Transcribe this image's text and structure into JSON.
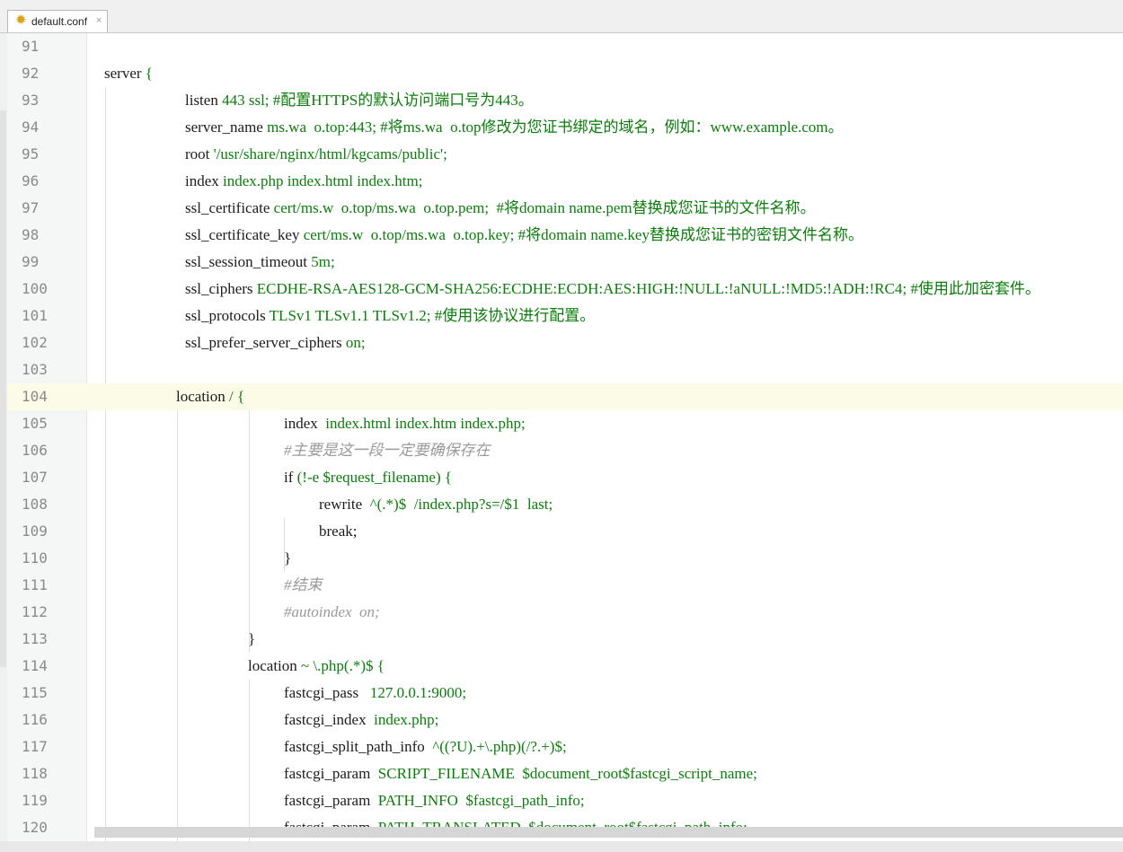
{
  "tab": {
    "label": "default.conf",
    "icon": "gear-icon",
    "close": "×"
  },
  "lines": [
    {
      "n": "91",
      "indent": 0,
      "parts": []
    },
    {
      "n": "92",
      "indent": 108,
      "parts": [
        [
          "kw",
          "server "
        ],
        [
          "val",
          "{"
        ]
      ]
    },
    {
      "n": "93",
      "indent": 198,
      "parts": [
        [
          "kw",
          "listen "
        ],
        [
          "val",
          "443 ssl; #配置HTTPS的默认访问端口号为443。"
        ]
      ]
    },
    {
      "n": "94",
      "indent": 198,
      "parts": [
        [
          "kw",
          "server_name "
        ],
        [
          "val",
          "ms.wa  o.top:443; #将ms.wa  o.top修改为您证书绑定的域名，例如：www.example.com。"
        ]
      ]
    },
    {
      "n": "95",
      "indent": 198,
      "parts": [
        [
          "kw",
          "root "
        ],
        [
          "val",
          "'/usr/share/nginx/html/kgcams/public';"
        ]
      ]
    },
    {
      "n": "96",
      "indent": 198,
      "parts": [
        [
          "kw",
          "index "
        ],
        [
          "val",
          "index.php index.html index.htm;"
        ]
      ]
    },
    {
      "n": "97",
      "indent": 198,
      "parts": [
        [
          "kw",
          "ssl_certificate "
        ],
        [
          "val",
          "cert/ms.w  o.top/ms.wa  o.top.pem;  #将domain name.pem替换成您证书的文件名称。"
        ]
      ]
    },
    {
      "n": "98",
      "indent": 198,
      "parts": [
        [
          "kw",
          "ssl_certificate_key "
        ],
        [
          "val",
          "cert/ms.w  o.top/ms.wa  o.top.key; #将domain name.key替换成您证书的密钥文件名称。"
        ]
      ]
    },
    {
      "n": "99",
      "indent": 198,
      "parts": [
        [
          "kw",
          "ssl_session_timeout "
        ],
        [
          "val",
          "5m;"
        ]
      ]
    },
    {
      "n": "100",
      "indent": 198,
      "parts": [
        [
          "kw",
          "ssl_ciphers "
        ],
        [
          "val",
          "ECDHE-RSA-AES128-GCM-SHA256:ECDHE:ECDH:AES:HIGH:!NULL:!aNULL:!MD5:!ADH:!RC4; #使用此加密套件。"
        ]
      ]
    },
    {
      "n": "101",
      "indent": 198,
      "parts": [
        [
          "kw",
          "ssl_protocols "
        ],
        [
          "val",
          "TLSv1 TLSv1.1 TLSv1.2; #使用该协议进行配置。"
        ]
      ]
    },
    {
      "n": "102",
      "indent": 198,
      "parts": [
        [
          "kw",
          "ssl_prefer_server_ciphers "
        ],
        [
          "val",
          "on;"
        ]
      ]
    },
    {
      "n": "103",
      "indent": 0,
      "parts": []
    },
    {
      "n": "104",
      "indent": 188,
      "current": true,
      "parts": [
        [
          "kw",
          "location "
        ],
        [
          "val",
          "/ {"
        ]
      ]
    },
    {
      "n": "105",
      "indent": 308,
      "parts": [
        [
          "kw",
          "index  "
        ],
        [
          "val",
          "index.html index.htm index.php;"
        ]
      ]
    },
    {
      "n": "106",
      "indent": 308,
      "parts": [
        [
          "cm",
          "#主要是这一段一定要确保存在"
        ]
      ]
    },
    {
      "n": "107",
      "indent": 308,
      "parts": [
        [
          "kw",
          "if "
        ],
        [
          "val",
          "(!-e $request_filename) {"
        ]
      ]
    },
    {
      "n": "108",
      "indent": 347,
      "parts": [
        [
          "kw",
          "rewrite  "
        ],
        [
          "val",
          "^(.*)$  /index.php?s=/$1  last;"
        ]
      ]
    },
    {
      "n": "109",
      "indent": 347,
      "parts": [
        [
          "kw",
          "break;"
        ]
      ]
    },
    {
      "n": "110",
      "indent": 308,
      "parts": [
        [
          "kw",
          "}"
        ]
      ]
    },
    {
      "n": "111",
      "indent": 308,
      "parts": [
        [
          "cm",
          "#结束"
        ]
      ]
    },
    {
      "n": "112",
      "indent": 308,
      "parts": [
        [
          "cm",
          "#autoindex  on;"
        ]
      ]
    },
    {
      "n": "113",
      "indent": 268,
      "parts": [
        [
          "kw",
          "}"
        ]
      ]
    },
    {
      "n": "114",
      "indent": 268,
      "parts": [
        [
          "kw",
          "location "
        ],
        [
          "val",
          "~ \\.php(.*)$ {"
        ]
      ]
    },
    {
      "n": "115",
      "indent": 308,
      "parts": [
        [
          "kw",
          "fastcgi_pass   "
        ],
        [
          "val",
          "127.0.0.1:9000;"
        ]
      ]
    },
    {
      "n": "116",
      "indent": 308,
      "parts": [
        [
          "kw",
          "fastcgi_index  "
        ],
        [
          "val",
          "index.php;"
        ]
      ]
    },
    {
      "n": "117",
      "indent": 308,
      "parts": [
        [
          "kw",
          "fastcgi_split_path_info  "
        ],
        [
          "val",
          "^((?U).+\\.php)(/?.+)$;"
        ]
      ]
    },
    {
      "n": "118",
      "indent": 308,
      "parts": [
        [
          "kw",
          "fastcgi_param  "
        ],
        [
          "val",
          "SCRIPT_FILENAME  $document_root$fastcgi_script_name;"
        ]
      ]
    },
    {
      "n": "119",
      "indent": 308,
      "parts": [
        [
          "kw",
          "fastcgi_param  "
        ],
        [
          "val",
          "PATH_INFO  $fastcgi_path_info;"
        ]
      ]
    },
    {
      "n": "120",
      "indent": 308,
      "parts": [
        [
          "kw",
          "fastcgi_param  "
        ],
        [
          "val",
          "PATH_TRANSLATED  $document_root$fastcgi_path_info;"
        ]
      ]
    }
  ]
}
